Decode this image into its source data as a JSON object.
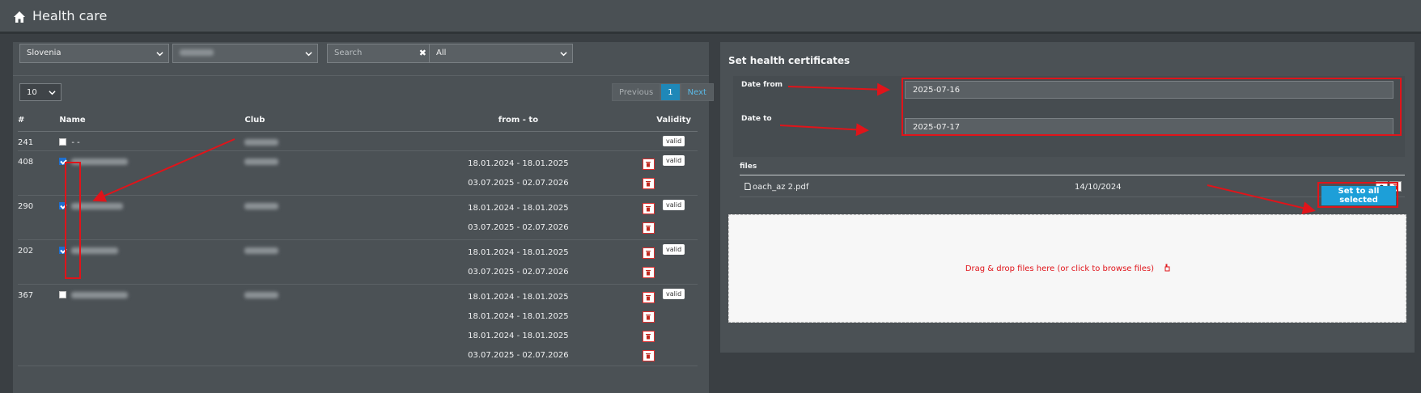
{
  "header": {
    "title": "Health care",
    "icon": "home-icon"
  },
  "filters": {
    "country": "Slovenia",
    "club": "",
    "search_placeholder": "Search",
    "validity": "All"
  },
  "page_size": "10",
  "pagination": {
    "previous": "Previous",
    "current": "1",
    "next": "Next"
  },
  "table": {
    "columns": [
      "#",
      "Name",
      "Club",
      "from - to",
      "Validity"
    ],
    "rows": [
      {
        "id": "241",
        "name": "- -",
        "checked": false,
        "periods": [],
        "validity": "valid"
      },
      {
        "id": "408",
        "name": "",
        "checked": true,
        "periods": [
          "18.01.2024 - 18.01.2025",
          "03.07.2025 - 02.07.2026"
        ],
        "validity": "valid"
      },
      {
        "id": "290",
        "name": "",
        "checked": true,
        "periods": [
          "18.01.2024 - 18.01.2025",
          "03.07.2025 - 02.07.2026"
        ],
        "validity": "valid"
      },
      {
        "id": "202",
        "name": "",
        "checked": true,
        "periods": [
          "18.01.2024 - 18.01.2025",
          "03.07.2025 - 02.07.2026"
        ],
        "validity": "valid"
      },
      {
        "id": "367",
        "name": "",
        "checked": false,
        "periods": [
          "18.01.2024 - 18.01.2025",
          "18.01.2024 - 18.01.2025",
          "18.01.2024 - 18.01.2025",
          "03.07.2025 - 02.07.2026"
        ],
        "validity": "valid"
      }
    ]
  },
  "certificates": {
    "title": "Set health certificates",
    "date_from_label": "Date from",
    "date_from": "2025-07-16",
    "date_to_label": "Date to",
    "date_to": "2025-07-17",
    "files_label": "files",
    "file": {
      "name": "oach_az 2.pdf",
      "date": "14/10/2024"
    },
    "set_button": "Set to all selected",
    "dropzone_text": "Drag & drop files here (or click to browse files)"
  },
  "colors": {
    "accent": "#1d9fd8",
    "annotation": "#e0141a",
    "panel": "#4b5155",
    "background": "#3a3f43"
  }
}
